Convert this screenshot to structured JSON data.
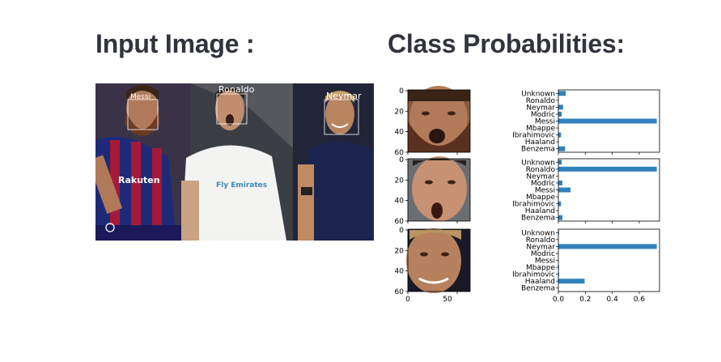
{
  "headings": {
    "input_image": "Input Image :",
    "class_probabilities": "Class Probabilities:"
  },
  "input_image": {
    "face_labels": [
      "Messi",
      "Ronaldo",
      "Neymar"
    ],
    "kit_text": [
      "Rakuten",
      "Fly Emirates"
    ]
  },
  "face_panels": {
    "y_ticks": [
      "0",
      "20",
      "40",
      "60"
    ],
    "x_ticks": [
      "0",
      "50"
    ]
  },
  "chart_data": {
    "type": "bar",
    "orientation": "horizontal",
    "categories": [
      "Unknown",
      "Ronaldo",
      "Neymar",
      "Modric",
      "Messi",
      "Mbappe",
      "Ibrahimovic",
      "Haaland",
      "Benzema"
    ],
    "x_ticks": [
      "0.0",
      "0.2",
      "0.4",
      "0.6"
    ],
    "xlim": [
      0,
      0.75
    ],
    "bar_color": "#3182bd",
    "panels": [
      {
        "face": "Messi",
        "values": [
          0.055,
          0.0,
          0.035,
          0.025,
          0.73,
          0.0,
          0.02,
          0.0,
          0.05
        ]
      },
      {
        "face": "Ronaldo",
        "values": [
          0.025,
          0.73,
          0.0,
          0.03,
          0.09,
          0.0,
          0.02,
          0.0,
          0.03
        ]
      },
      {
        "face": "Neymar",
        "values": [
          0.005,
          0.0,
          0.73,
          0.0,
          0.0,
          0.005,
          0.005,
          0.195,
          0.0
        ]
      }
    ]
  }
}
